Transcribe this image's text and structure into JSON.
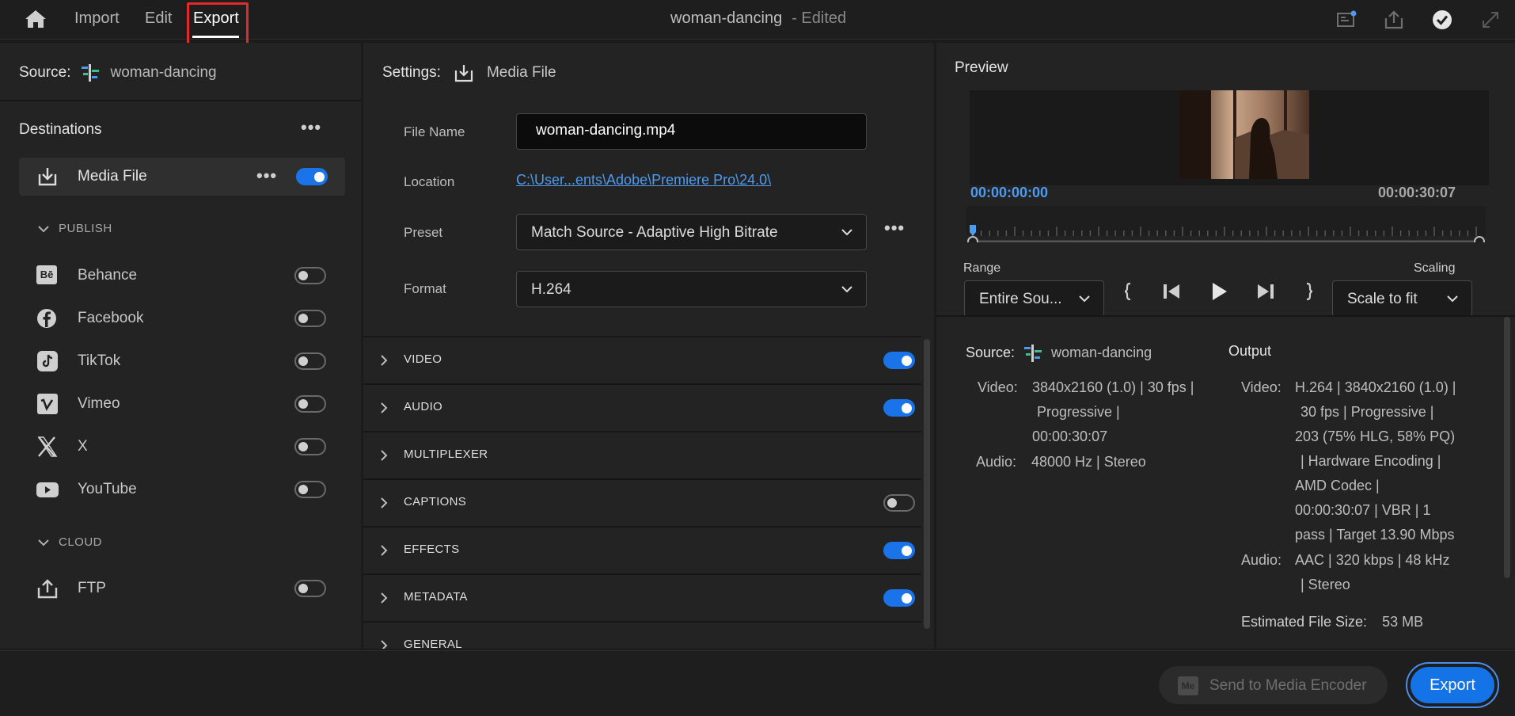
{
  "topbar": {
    "nav": [
      "Import",
      "Edit",
      "Export"
    ],
    "active_tab": "Export",
    "title": "woman-dancing",
    "title_status": "- Edited"
  },
  "left": {
    "source_label": "Source:",
    "source_name": "woman-dancing",
    "destinations_title": "Destinations",
    "media_file": {
      "label": "Media File",
      "enabled": true
    },
    "publish_header": "PUBLISH",
    "publish_items": [
      {
        "label": "Behance",
        "icon": "behance-icon",
        "enabled": false
      },
      {
        "label": "Facebook",
        "icon": "facebook-icon",
        "enabled": false
      },
      {
        "label": "TikTok",
        "icon": "tiktok-icon",
        "enabled": false
      },
      {
        "label": "Vimeo",
        "icon": "vimeo-icon",
        "enabled": false
      },
      {
        "label": "X",
        "icon": "x-icon",
        "enabled": false
      },
      {
        "label": "YouTube",
        "icon": "youtube-icon",
        "enabled": false
      }
    ],
    "cloud_header": "CLOUD",
    "cloud_items": [
      {
        "label": "FTP",
        "icon": "ftp-icon",
        "enabled": false
      }
    ]
  },
  "settings": {
    "label": "Settings:",
    "mode": "Media File",
    "file_name_label": "File Name",
    "file_name": "woman-dancing.mp4",
    "location_label": "Location",
    "location": "C:\\User...ents\\Adobe\\Premiere Pro\\24.0\\",
    "preset_label": "Preset",
    "preset": "Match Source - Adaptive High Bitrate",
    "format_label": "Format",
    "format": "H.264",
    "sections": [
      {
        "label": "VIDEO",
        "toggle": "on"
      },
      {
        "label": "AUDIO",
        "toggle": "on"
      },
      {
        "label": "MULTIPLEXER",
        "toggle": "none"
      },
      {
        "label": "CAPTIONS",
        "toggle": "off"
      },
      {
        "label": "EFFECTS",
        "toggle": "on"
      },
      {
        "label": "METADATA",
        "toggle": "on"
      },
      {
        "label": "GENERAL",
        "toggle": "none"
      }
    ]
  },
  "preview": {
    "title": "Preview",
    "timecode_start": "00:00:00:00",
    "timecode_end": "00:00:30:07",
    "range_label": "Range",
    "range_value": "Entire Sou...",
    "scaling_label": "Scaling",
    "scaling_value": "Scale to fit",
    "playhead_position": 0
  },
  "summary": {
    "source_label": "Source:",
    "source_name": "woman-dancing",
    "source_video_label": "Video:",
    "source_video_lines": [
      "3840x2160 (1.0) | 30 fps |",
      "Progressive |",
      "00:00:30:07"
    ],
    "source_audio_label": "Audio:",
    "source_audio": "48000 Hz | Stereo",
    "output_label": "Output",
    "output_video_label": "Video:",
    "output_video_lines": [
      "H.264 | 3840x2160 (1.0) |",
      "30 fps | Progressive |",
      "203 (75% HLG, 58% PQ)",
      "| Hardware Encoding |",
      "AMD Codec |",
      "00:00:30:07 | VBR | 1",
      "pass | Target 13.90 Mbps"
    ],
    "output_audio_label": "Audio:",
    "output_audio_lines": [
      "AAC | 320 kbps | 48 kHz",
      "| Stereo"
    ],
    "file_size_label": "Estimated File Size:",
    "file_size": "53 MB"
  },
  "bottom": {
    "send_label": "Send to Media Encoder",
    "send_icon_text": "Me",
    "export_label": "Export"
  },
  "colors": {
    "accent": "#1473e6",
    "highlight": "#e32a2a",
    "timecode": "#4d9bf0"
  }
}
